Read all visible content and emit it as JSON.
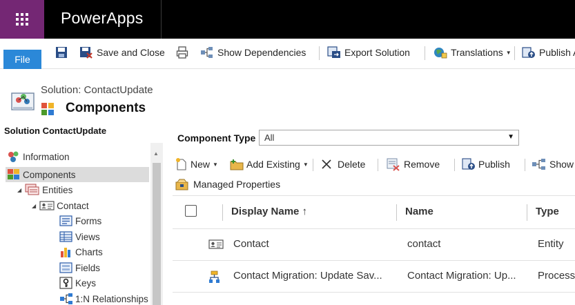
{
  "app": {
    "title": "PowerApps"
  },
  "commandbar": {
    "file_label": "File",
    "save_close": "Save and Close",
    "show_dependencies": "Show Dependencies",
    "export_solution": "Export Solution",
    "translations": "Translations",
    "publish_all": "Publish A"
  },
  "header": {
    "solution_subtitle": "Solution: ContactUpdate",
    "page_title": "Components"
  },
  "nav": {
    "heading": "Solution ContactUpdate",
    "items": [
      {
        "label": "Information",
        "icon": "information-icon",
        "level": 0
      },
      {
        "label": "Components",
        "icon": "components-icon",
        "level": 0,
        "selected": true
      },
      {
        "label": "Entities",
        "icon": "entities-icon",
        "level": 1
      },
      {
        "label": "Contact",
        "icon": "contact-entity-icon",
        "level": 2
      },
      {
        "label": "Forms",
        "icon": "forms-icon",
        "level": 3
      },
      {
        "label": "Views",
        "icon": "views-icon",
        "level": 3
      },
      {
        "label": "Charts",
        "icon": "charts-icon",
        "level": 3
      },
      {
        "label": "Fields",
        "icon": "fields-icon",
        "level": 3
      },
      {
        "label": "Keys",
        "icon": "keys-icon",
        "level": 3
      },
      {
        "label": "1:N Relationships",
        "icon": "relationships-icon",
        "level": 3
      }
    ]
  },
  "filter": {
    "label": "Component Type",
    "selected": "All"
  },
  "toolbar": {
    "new": "New",
    "add_existing": "Add Existing",
    "delete": "Delete",
    "remove": "Remove",
    "publish": "Publish",
    "show": "Show",
    "managed_properties": "Managed Properties"
  },
  "grid": {
    "columns": {
      "display_name": "Display Name ↑",
      "name": "Name",
      "type": "Type"
    },
    "rows": [
      {
        "display_name": "Contact",
        "name": "contact",
        "type": "Entity",
        "icon": "contact-entity-icon"
      },
      {
        "display_name": "Contact Migration: Update Sav...",
        "name": "Contact Migration: Up...",
        "type": "Process",
        "icon": "process-icon"
      }
    ]
  },
  "colors": {
    "waffle_bg": "#742774",
    "topbar_bg": "#000000",
    "file_button": "#2b88d8",
    "nav_selected": "#dcdcdc"
  }
}
